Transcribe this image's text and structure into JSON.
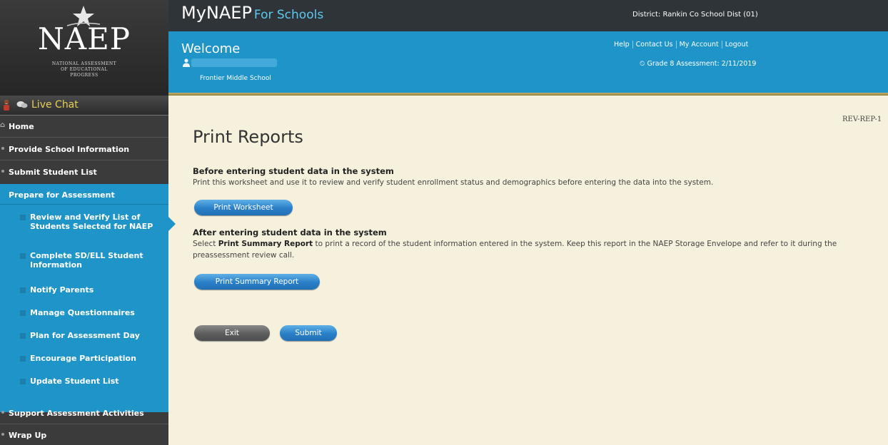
{
  "header": {
    "logo": {
      "word": "NAEP",
      "sub_lines": [
        "NATIONAL ASSESSMENT",
        "OF EDUCATIONAL",
        "PROGRESS"
      ]
    },
    "app_name": "MyNAEP",
    "app_suffix": "For Schools",
    "district": "District: Rankin Co School Dist (01)",
    "welcome": "Welcome",
    "school": "Frontier Middle School",
    "links": [
      "Help",
      "Contact Us",
      "My Account",
      "Logout"
    ],
    "assessment_date": "Grade 8 Assessment: 2/11/2019"
  },
  "sidebar": {
    "live_chat": "Live Chat",
    "home": "Home",
    "items": [
      "Provide School Information",
      "Submit Student List",
      "Prepare for Assessment",
      "Support Assessment Activities",
      "Wrap Up"
    ],
    "subitems": [
      [
        "Review and Verify List of",
        "Students Selected for NAEP"
      ],
      [
        "Complete SD/ELL Student",
        "Information"
      ],
      [
        "Notify Parents"
      ],
      [
        "Manage Questionnaires"
      ],
      [
        "Plan for Assessment Day"
      ],
      [
        "Encourage Participation"
      ],
      [
        "Update Student List"
      ]
    ]
  },
  "main": {
    "page_id": "REV-REP-1",
    "title": "Print Reports",
    "section1": {
      "title": "Before entering student data in the system",
      "text": "Print this worksheet and use it to review and verify student enrollment status and demographics before entering the data into the system.",
      "button": "Print Worksheet"
    },
    "section2": {
      "title": "After entering student data in the system",
      "text_pre": "Select ",
      "text_bold": "Print Summary Report",
      "text_post": " to print a record of the student information entered in the system. Keep this report in the NAEP Storage Envelope and refer to it during the preassessment review call.",
      "button": "Print Summary Report"
    },
    "exit": "Exit",
    "submit": "Submit"
  },
  "colors": {
    "sidebar_bg": "#3b3b3b",
    "accent_blue": "#1e94c9",
    "topbar": "#2f3439",
    "page_bg": "#f6f1dc",
    "live_chat": "#e7cf55"
  }
}
